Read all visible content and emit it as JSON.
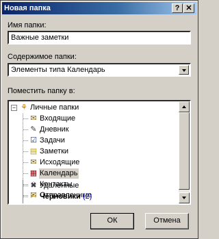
{
  "window": {
    "title": "Новая папка",
    "help_button": "?",
    "close_button": "✕"
  },
  "name_field": {
    "label": "Имя папки:",
    "value": "Важные заметки"
  },
  "contents_field": {
    "label": "Содержимое папки:",
    "value": "Элементы типа Календарь"
  },
  "location": {
    "label": "Поместить папку в:",
    "root": {
      "label": "Личные папки",
      "icon": "personal-folders-icon",
      "expander": "−"
    },
    "items": [
      {
        "label": "Входящие",
        "icon": "inbox-icon"
      },
      {
        "label": "Дневник",
        "icon": "journal-icon"
      },
      {
        "label": "Задачи",
        "icon": "tasks-icon"
      },
      {
        "label": "Заметки",
        "icon": "notes-icon"
      },
      {
        "label": "Исходящие",
        "icon": "outbox-icon"
      },
      {
        "label": "Календарь",
        "icon": "calendar-icon"
      },
      {
        "label": "Контакты",
        "icon": "contacts-icon"
      },
      {
        "label": "Отправленные",
        "icon": "sent-icon"
      },
      {
        "label": "Удаленные",
        "icon": "deleted-icon"
      },
      {
        "label": "Черновики",
        "icon": "drafts-icon",
        "count": "(2)"
      }
    ]
  },
  "buttons": {
    "ok": "ОК",
    "cancel": "Отмена"
  }
}
